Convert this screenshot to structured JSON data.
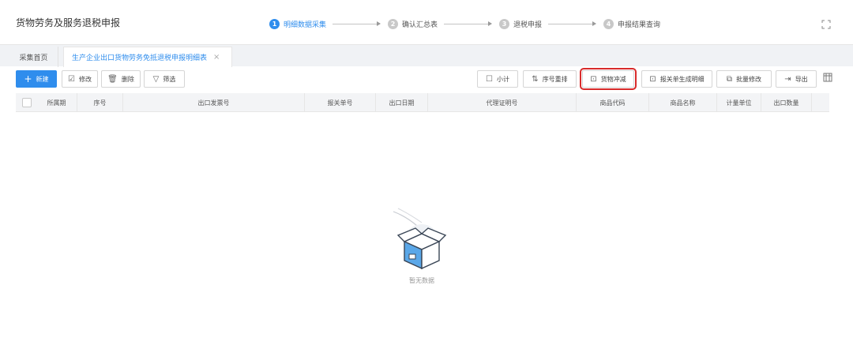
{
  "header": {
    "title": "货物劳务及服务退税申报",
    "steps": [
      {
        "num": "1",
        "label": "明细数据采集",
        "active": true
      },
      {
        "num": "2",
        "label": "确认汇总表",
        "active": false
      },
      {
        "num": "3",
        "label": "退税申报",
        "active": false
      },
      {
        "num": "4",
        "label": "申报结果查询",
        "active": false
      }
    ]
  },
  "tabs": {
    "home": "采集首页",
    "active": "生产企业出口货物劳务免抵退税申报明细表",
    "close": "×"
  },
  "toolbar": {
    "left": [
      {
        "icon": "+",
        "label": "新建"
      },
      {
        "icon": "☑",
        "label": "修改"
      },
      {
        "icon": "🗑",
        "label": "删除"
      },
      {
        "icon": "▽",
        "label": "筛选"
      }
    ],
    "right": [
      {
        "icon": "☐",
        "label": "小计"
      },
      {
        "icon": "⇅",
        "label": "序号重排"
      },
      {
        "icon": "⊡",
        "label": "货物冲减"
      },
      {
        "icon": "⊡",
        "label": "报关单生成明细"
      },
      {
        "icon": "⧉",
        "label": "批量修改"
      },
      {
        "icon": "⇥",
        "label": "导出"
      }
    ]
  },
  "table": {
    "columns": [
      "所属期",
      "序号",
      "出口发票号",
      "报关单号",
      "出口日期",
      "代理证明号",
      "商品代码",
      "商品名称",
      "计量单位",
      "出口数量"
    ]
  },
  "empty": {
    "text": "暂无数据"
  },
  "colors": {
    "accent": "#2f8ded",
    "highlight": "#d82b2b"
  }
}
